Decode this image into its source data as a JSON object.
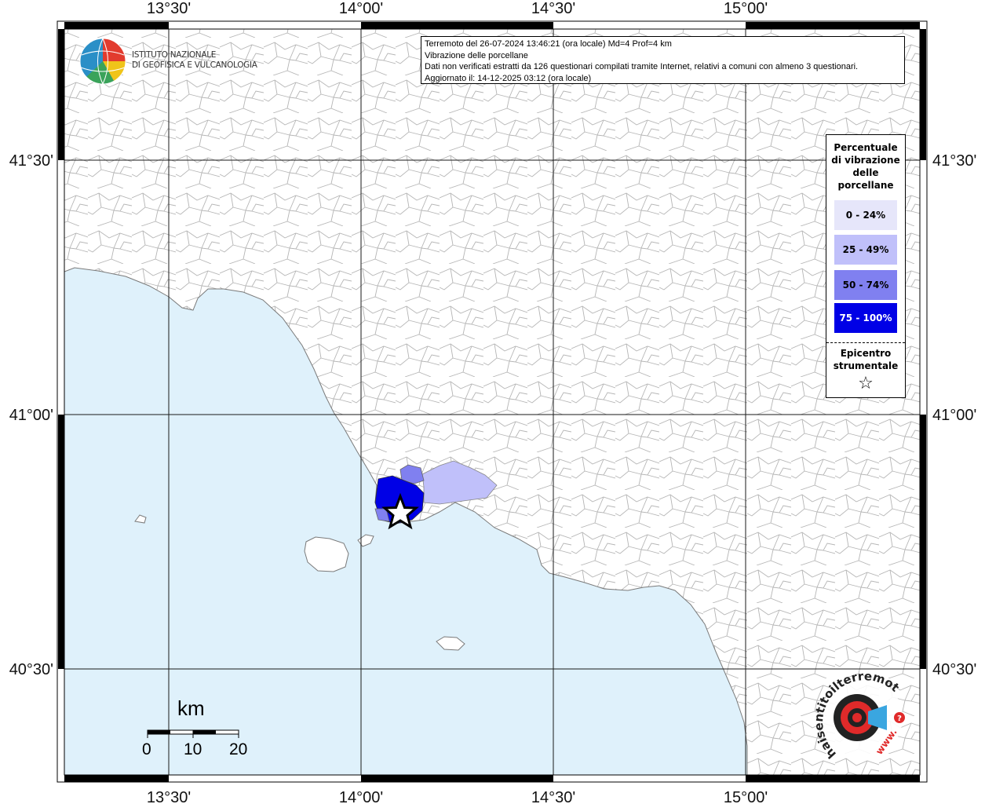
{
  "map": {
    "longitude_labels": [
      "13°30'",
      "14°00'",
      "14°30'",
      "15°00'"
    ],
    "latitude_labels": [
      "41°30'",
      "41°00'",
      "40°30'"
    ],
    "epicenter_icon": "star-icon",
    "colors": {
      "sea": "#dff1fb",
      "land": "#ffffff",
      "boundary": "#b5b5b5",
      "class_0_24": "#e6e6fa",
      "class_25_49": "#c0c0fa",
      "class_50_74": "#8080f0",
      "class_75_100": "#0000e6"
    }
  },
  "info": {
    "line1": "Terremoto del 26-07-2024 13:46:21 (ora locale) Md=4 Prof=4 km",
    "line2": "Vibrazione delle porcellane",
    "line3": "Dati non verificati estratti da 126 questionari compilati tramite Internet, relativi a comuni con almeno 3 questionari.",
    "line4": "Aggiornato il: 14-12-2025 03:12 (ora locale)"
  },
  "logo": {
    "line1": "ISTITUTO NAZIONALE",
    "line2": "DI GEOFISICA E VULCANOLOGIA"
  },
  "legend": {
    "title_lines": [
      "Percentuale",
      "di vibrazione",
      "delle",
      "porcellane"
    ],
    "classes": [
      "0 - 24%",
      "25 - 49%",
      "50 - 74%",
      "75 - 100%"
    ],
    "epicenter_lines": [
      "Epicentro",
      "strumentale"
    ],
    "epicenter_symbol": "☆"
  },
  "scale": {
    "unit": "km",
    "ticks": [
      "0",
      "10",
      "20"
    ]
  },
  "haisentito": {
    "text": "haisentitoilterremoto.it",
    "url_text": "www."
  }
}
